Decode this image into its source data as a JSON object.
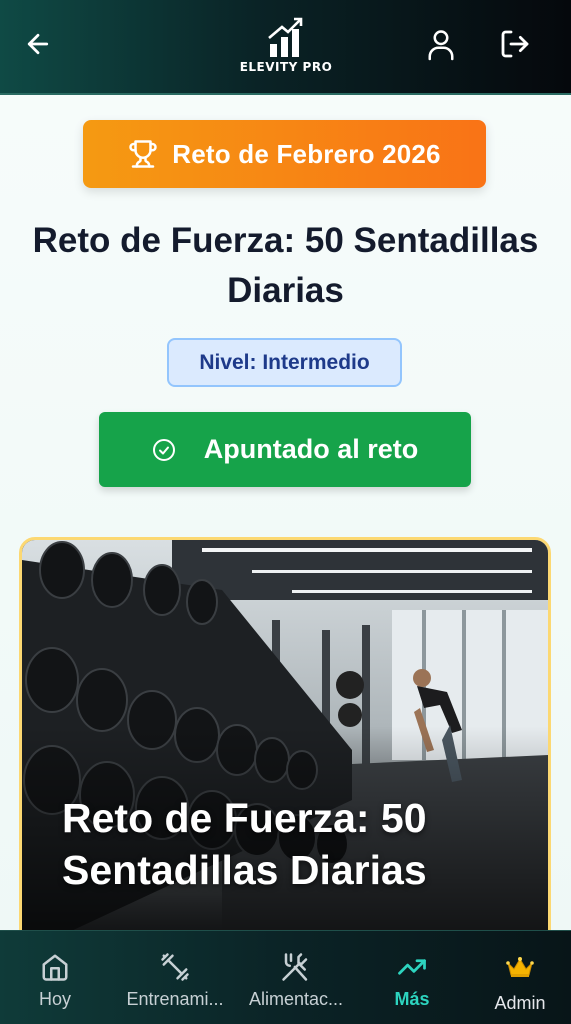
{
  "header": {
    "logo_text": "ELEVITY PRO",
    "back_icon": "arrow-left-icon",
    "user_icon": "user-icon",
    "logout_icon": "logout-icon"
  },
  "challenge": {
    "badge_label": "Reto de Febrero 2026",
    "badge_icon": "trophy-icon",
    "title": "Reto de Fuerza: 50 Sentadillas Diarias",
    "level_label": "Nivel: Intermedio",
    "join_label": "Apuntado al reto",
    "join_icon": "check-circle-icon"
  },
  "hero": {
    "title": "Reto de Fuerza: 50 Sentadillas Diarias"
  },
  "nav": {
    "items": [
      {
        "label": "Hoy",
        "icon": "home-icon"
      },
      {
        "label": "Entrenami...",
        "icon": "dumbbell-icon"
      },
      {
        "label": "Alimentac...",
        "icon": "utensils-icon"
      },
      {
        "label": "Más",
        "icon": "trending-up-icon",
        "active": true
      },
      {
        "label": "Admin",
        "icon": "crown-icon"
      }
    ]
  },
  "colors": {
    "accent_orange": "#f97316",
    "join_green": "#16a34a",
    "level_blue": "#dbeafe",
    "nav_active": "#2dd4bf"
  }
}
